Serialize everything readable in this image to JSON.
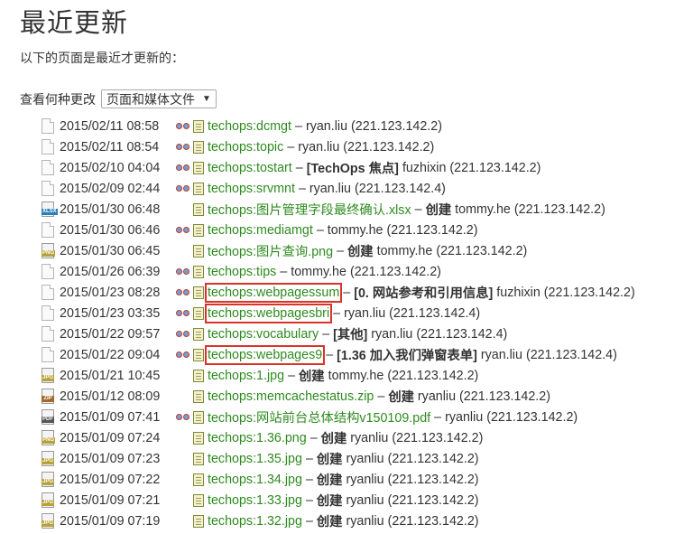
{
  "page": {
    "title": "最近更新",
    "intro": "以下的页面是最近才更新的：",
    "filter_label": "查看何种更改",
    "filter_value": "页面和媒体文件"
  },
  "colors": {
    "link": "#2e8b1f",
    "highlight": "#d9342b"
  },
  "changes": [
    {
      "icon": "page",
      "date": "2015/02/11 08:58",
      "diff": true,
      "link": "techops:dcmgt",
      "sep": "–",
      "summary": "",
      "user": "ryan.liu",
      "ip": "(221.123.142.2)",
      "boxed": false
    },
    {
      "icon": "page",
      "date": "2015/02/11 08:54",
      "diff": true,
      "link": "techops:topic",
      "sep": "–",
      "summary": "",
      "user": "ryan.liu",
      "ip": "(221.123.142.2)",
      "boxed": false
    },
    {
      "icon": "page",
      "date": "2015/02/10 04:04",
      "diff": true,
      "link": "techops:tostart",
      "sep": "–",
      "summary": "[TechOps 焦点]",
      "user": "fuzhixin",
      "ip": "(221.123.142.2)",
      "boxed": false
    },
    {
      "icon": "page",
      "date": "2015/02/09 02:44",
      "diff": true,
      "link": "techops:srvmnt",
      "sep": "–",
      "summary": "",
      "user": "ryan.liu",
      "ip": "(221.123.142.4)",
      "boxed": false
    },
    {
      "icon": "xlsx",
      "date": "2015/01/30 06:48",
      "diff": false,
      "link": "techops:图片管理字段最终确认.xlsx",
      "sep": "–",
      "summary": "创建",
      "user": "tommy.he",
      "ip": "(221.123.142.2)",
      "boxed": false
    },
    {
      "icon": "page",
      "date": "2015/01/30 06:46",
      "diff": true,
      "link": "techops:mediamgt",
      "sep": "–",
      "summary": "",
      "user": "tommy.he",
      "ip": "(221.123.142.2)",
      "boxed": false
    },
    {
      "icon": "png",
      "date": "2015/01/30 06:45",
      "diff": false,
      "link": "techops:图片查询.png",
      "sep": "–",
      "summary": "创建",
      "user": "tommy.he",
      "ip": "(221.123.142.2)",
      "boxed": false
    },
    {
      "icon": "page",
      "date": "2015/01/26 06:39",
      "diff": true,
      "link": "techops:tips",
      "sep": "–",
      "summary": "",
      "user": "tommy.he",
      "ip": "(221.123.142.2)",
      "boxed": false
    },
    {
      "icon": "page",
      "date": "2015/01/23 08:28",
      "diff": true,
      "link": "techops:webpagessum",
      "sep": "–",
      "summary": "[0. 网站参考和引用信息]",
      "user": "fuzhixin",
      "ip": "(221.123.142.2)",
      "boxed": true
    },
    {
      "icon": "page",
      "date": "2015/01/23 03:35",
      "diff": true,
      "link": "techops:webpagesbri",
      "sep": "–",
      "summary": "",
      "user": "ryan.liu",
      "ip": "(221.123.142.4)",
      "boxed": true
    },
    {
      "icon": "page",
      "date": "2015/01/22 09:57",
      "diff": true,
      "link": "techops:vocabulary",
      "sep": "–",
      "summary": "[其他]",
      "user": "ryan.liu",
      "ip": "(221.123.142.4)",
      "boxed": false
    },
    {
      "icon": "page",
      "date": "2015/01/22 09:04",
      "diff": true,
      "link": "techops:webpages9",
      "sep": "–",
      "summary": "[1.36 加入我们弹窗表单]",
      "user": "ryan.liu",
      "ip": "(221.123.142.4)",
      "boxed": true
    },
    {
      "icon": "jpg",
      "date": "2015/01/21 10:45",
      "diff": false,
      "link": "techops:1.jpg",
      "sep": "–",
      "summary": "创建",
      "user": "tommy.he",
      "ip": "(221.123.142.2)",
      "boxed": false
    },
    {
      "icon": "zip",
      "date": "2015/01/12 08:09",
      "diff": false,
      "link": "techops:memcachestatus.zip",
      "sep": "–",
      "summary": "创建",
      "user": "ryanliu",
      "ip": "(221.123.142.2)",
      "boxed": false
    },
    {
      "icon": "pdf",
      "date": "2015/01/09 07:41",
      "diff": true,
      "link": "techops:网站前台总体结构v150109.pdf",
      "sep": "–",
      "summary": "",
      "user": "ryanliu",
      "ip": "(221.123.142.2)",
      "boxed": false
    },
    {
      "icon": "png",
      "date": "2015/01/09 07:24",
      "diff": false,
      "link": "techops:1.36.png",
      "sep": "–",
      "summary": "创建",
      "user": "ryanliu",
      "ip": "(221.123.142.2)",
      "boxed": false
    },
    {
      "icon": "jpg",
      "date": "2015/01/09 07:23",
      "diff": false,
      "link": "techops:1.35.jpg",
      "sep": "–",
      "summary": "创建",
      "user": "ryanliu",
      "ip": "(221.123.142.2)",
      "boxed": false
    },
    {
      "icon": "jpg",
      "date": "2015/01/09 07:22",
      "diff": false,
      "link": "techops:1.34.jpg",
      "sep": "–",
      "summary": "创建",
      "user": "ryanliu",
      "ip": "(221.123.142.2)",
      "boxed": false
    },
    {
      "icon": "jpg",
      "date": "2015/01/09 07:21",
      "diff": false,
      "link": "techops:1.33.jpg",
      "sep": "–",
      "summary": "创建",
      "user": "ryanliu",
      "ip": "(221.123.142.2)",
      "boxed": false
    },
    {
      "icon": "jpg",
      "date": "2015/01/09 07:19",
      "diff": false,
      "link": "techops:1.32.jpg",
      "sep": "–",
      "summary": "创建",
      "user": "ryanliu",
      "ip": "(221.123.142.2)",
      "boxed": false
    }
  ],
  "icon_labels": {
    "xlsx": "XLSX",
    "png": "PNG",
    "jpg": "JPG",
    "zip": "ZIP",
    "pdf": "PDF"
  },
  "icon_colors": {
    "xlsx": "#2a7fb8",
    "png": "#b8a23a",
    "jpg": "#b8a23a",
    "zip": "#a06a2a",
    "pdf": "#555555"
  }
}
